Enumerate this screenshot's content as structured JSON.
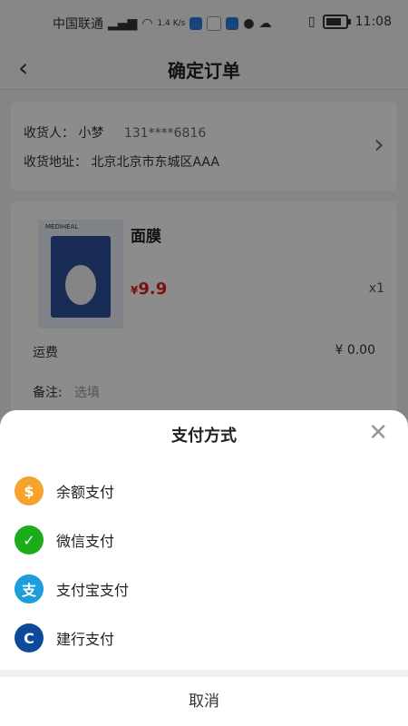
{
  "status_bar": {
    "carrier": "中国联通",
    "net_speed": "1.4 K/s",
    "time": "11:08"
  },
  "nav": {
    "back_icon": "chevron-left-icon",
    "title": "确定订单"
  },
  "address": {
    "recipient_label": "收货人：",
    "recipient_name": "小梦",
    "phone": "131****6816",
    "address_label": "收货地址：",
    "address_value": "北京北京市东城区AAA"
  },
  "product": {
    "name": "面膜",
    "currency": "¥",
    "price": "9.9",
    "quantity": "x1",
    "brand": "MEDIHEAL"
  },
  "shipping": {
    "label": "运费",
    "value": "¥ 0.00"
  },
  "note": {
    "label": "备注:",
    "placeholder": "选填"
  },
  "payment_sheet": {
    "title": "支付方式",
    "options": [
      {
        "label": "余额支付",
        "icon": "wallet-icon",
        "color": "#f5a32b"
      },
      {
        "label": "微信支付",
        "icon": "wechat-icon",
        "color": "#1aad19"
      },
      {
        "label": "支付宝支付",
        "icon": "alipay-icon",
        "color": "#1d9ddc"
      },
      {
        "label": "建行支付",
        "icon": "ccb-icon",
        "color": "#0e4a9a"
      }
    ],
    "cancel_label": "取消"
  }
}
